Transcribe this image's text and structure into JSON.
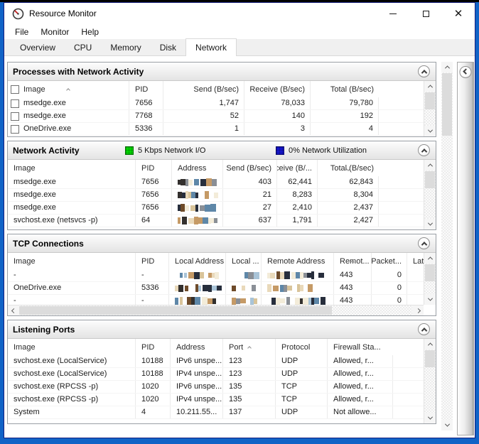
{
  "window": {
    "title": "Resource Monitor",
    "controls": {
      "minimize": "minimize",
      "maximize": "maximize",
      "close": "✕"
    }
  },
  "menu": {
    "file": "File",
    "monitor": "Monitor",
    "help": "Help"
  },
  "tabs": [
    {
      "label": "Overview",
      "active": false
    },
    {
      "label": "CPU",
      "active": false
    },
    {
      "label": "Memory",
      "active": false
    },
    {
      "label": "Disk",
      "active": false
    },
    {
      "label": "Network",
      "active": true
    }
  ],
  "sections": [
    {
      "id": "processes-with-network-activity",
      "title": "Processes with Network Activity",
      "checkboxes": true,
      "columns": [
        {
          "label": "Image",
          "sort": "up"
        },
        {
          "label": "PID"
        },
        {
          "label": "Send (B/sec)",
          "align": "right"
        },
        {
          "label": "Receive (B/sec)",
          "align": "right"
        },
        {
          "label": "Total (B/sec)",
          "align": "right"
        }
      ],
      "rows": [
        [
          "msedge.exe",
          "7656",
          "1,747",
          "78,033",
          "79,780"
        ],
        [
          "msedge.exe",
          "7768",
          "52",
          "140",
          "192"
        ],
        [
          "OneDrive.exe",
          "5336",
          "1",
          "3",
          "4"
        ]
      ]
    },
    {
      "id": "network-activity",
      "title": "Network Activity",
      "legend": [
        {
          "color": "#00d400",
          "label": "5 Kbps Network I/O"
        },
        {
          "color": "#1414cc",
          "label": "0% Network Utilization"
        }
      ],
      "columns": [
        {
          "label": "Image"
        },
        {
          "label": "PID"
        },
        {
          "label": "Address",
          "mosaic": true,
          "mw": 52
        },
        {
          "label": "Send (B/sec)",
          "align": "right"
        },
        {
          "label": "Receive (B/...",
          "align": "right"
        },
        {
          "label": "Total (B/sec)",
          "align": "right",
          "sort": "down"
        }
      ],
      "rows": [
        [
          "msedge.exe",
          "7656",
          null,
          "403",
          "62,441",
          "62,843"
        ],
        [
          "msedge.exe",
          "7656",
          null,
          "21",
          "8,283",
          "8,304"
        ],
        [
          "msedge.exe",
          "7656",
          null,
          "27",
          "2,410",
          "2,437"
        ],
        [
          "svchost.exe (netsvcs -p)",
          "64",
          null,
          "637",
          "1,791",
          "2,427"
        ]
      ]
    },
    {
      "id": "tcp-connections",
      "title": "TCP Connections",
      "hscroll": true,
      "columns": [
        {
          "label": "Image"
        },
        {
          "label": "PID"
        },
        {
          "label": "Local Address",
          "mosaic": true,
          "mw": 60
        },
        {
          "label": "Local ...",
          "mosaic": true,
          "mw": 34
        },
        {
          "label": "Remote Address",
          "mosaic": true,
          "mw": 82
        },
        {
          "label": "Remot...",
          "sort": "up"
        },
        {
          "label": "Packet...",
          "align": "right"
        },
        {
          "label": "Late..."
        }
      ],
      "rows": [
        [
          "-",
          "-",
          null,
          null,
          null,
          "443",
          "0"
        ],
        [
          "OneDrive.exe",
          "5336",
          null,
          null,
          null,
          "443",
          "0"
        ],
        [
          "-",
          "-",
          null,
          null,
          null,
          "443",
          "0"
        ]
      ]
    },
    {
      "id": "listening-ports",
      "title": "Listening Ports",
      "columns": [
        {
          "label": "Image"
        },
        {
          "label": "PID"
        },
        {
          "label": "Address"
        },
        {
          "label": "Port",
          "sort": "up"
        },
        {
          "label": "Protocol"
        },
        {
          "label": "Firewall Sta..."
        }
      ],
      "rows": [
        [
          "svchost.exe (LocalService)",
          "10188",
          "IPv6 unspe...",
          "123",
          "UDP",
          "Allowed, r..."
        ],
        [
          "svchost.exe (LocalService)",
          "10188",
          "IPv4 unspe...",
          "123",
          "UDP",
          "Allowed, r..."
        ],
        [
          "svchost.exe (RPCSS -p)",
          "1020",
          "IPv6 unspe...",
          "135",
          "TCP",
          "Allowed, r..."
        ],
        [
          "svchost.exe (RPCSS -p)",
          "1020",
          "IPv4 unspe...",
          "135",
          "TCP",
          "Allowed, r..."
        ],
        [
          "System",
          "4",
          "10.211.55...",
          "137",
          "UDP",
          "Not allowe..."
        ]
      ]
    }
  ]
}
